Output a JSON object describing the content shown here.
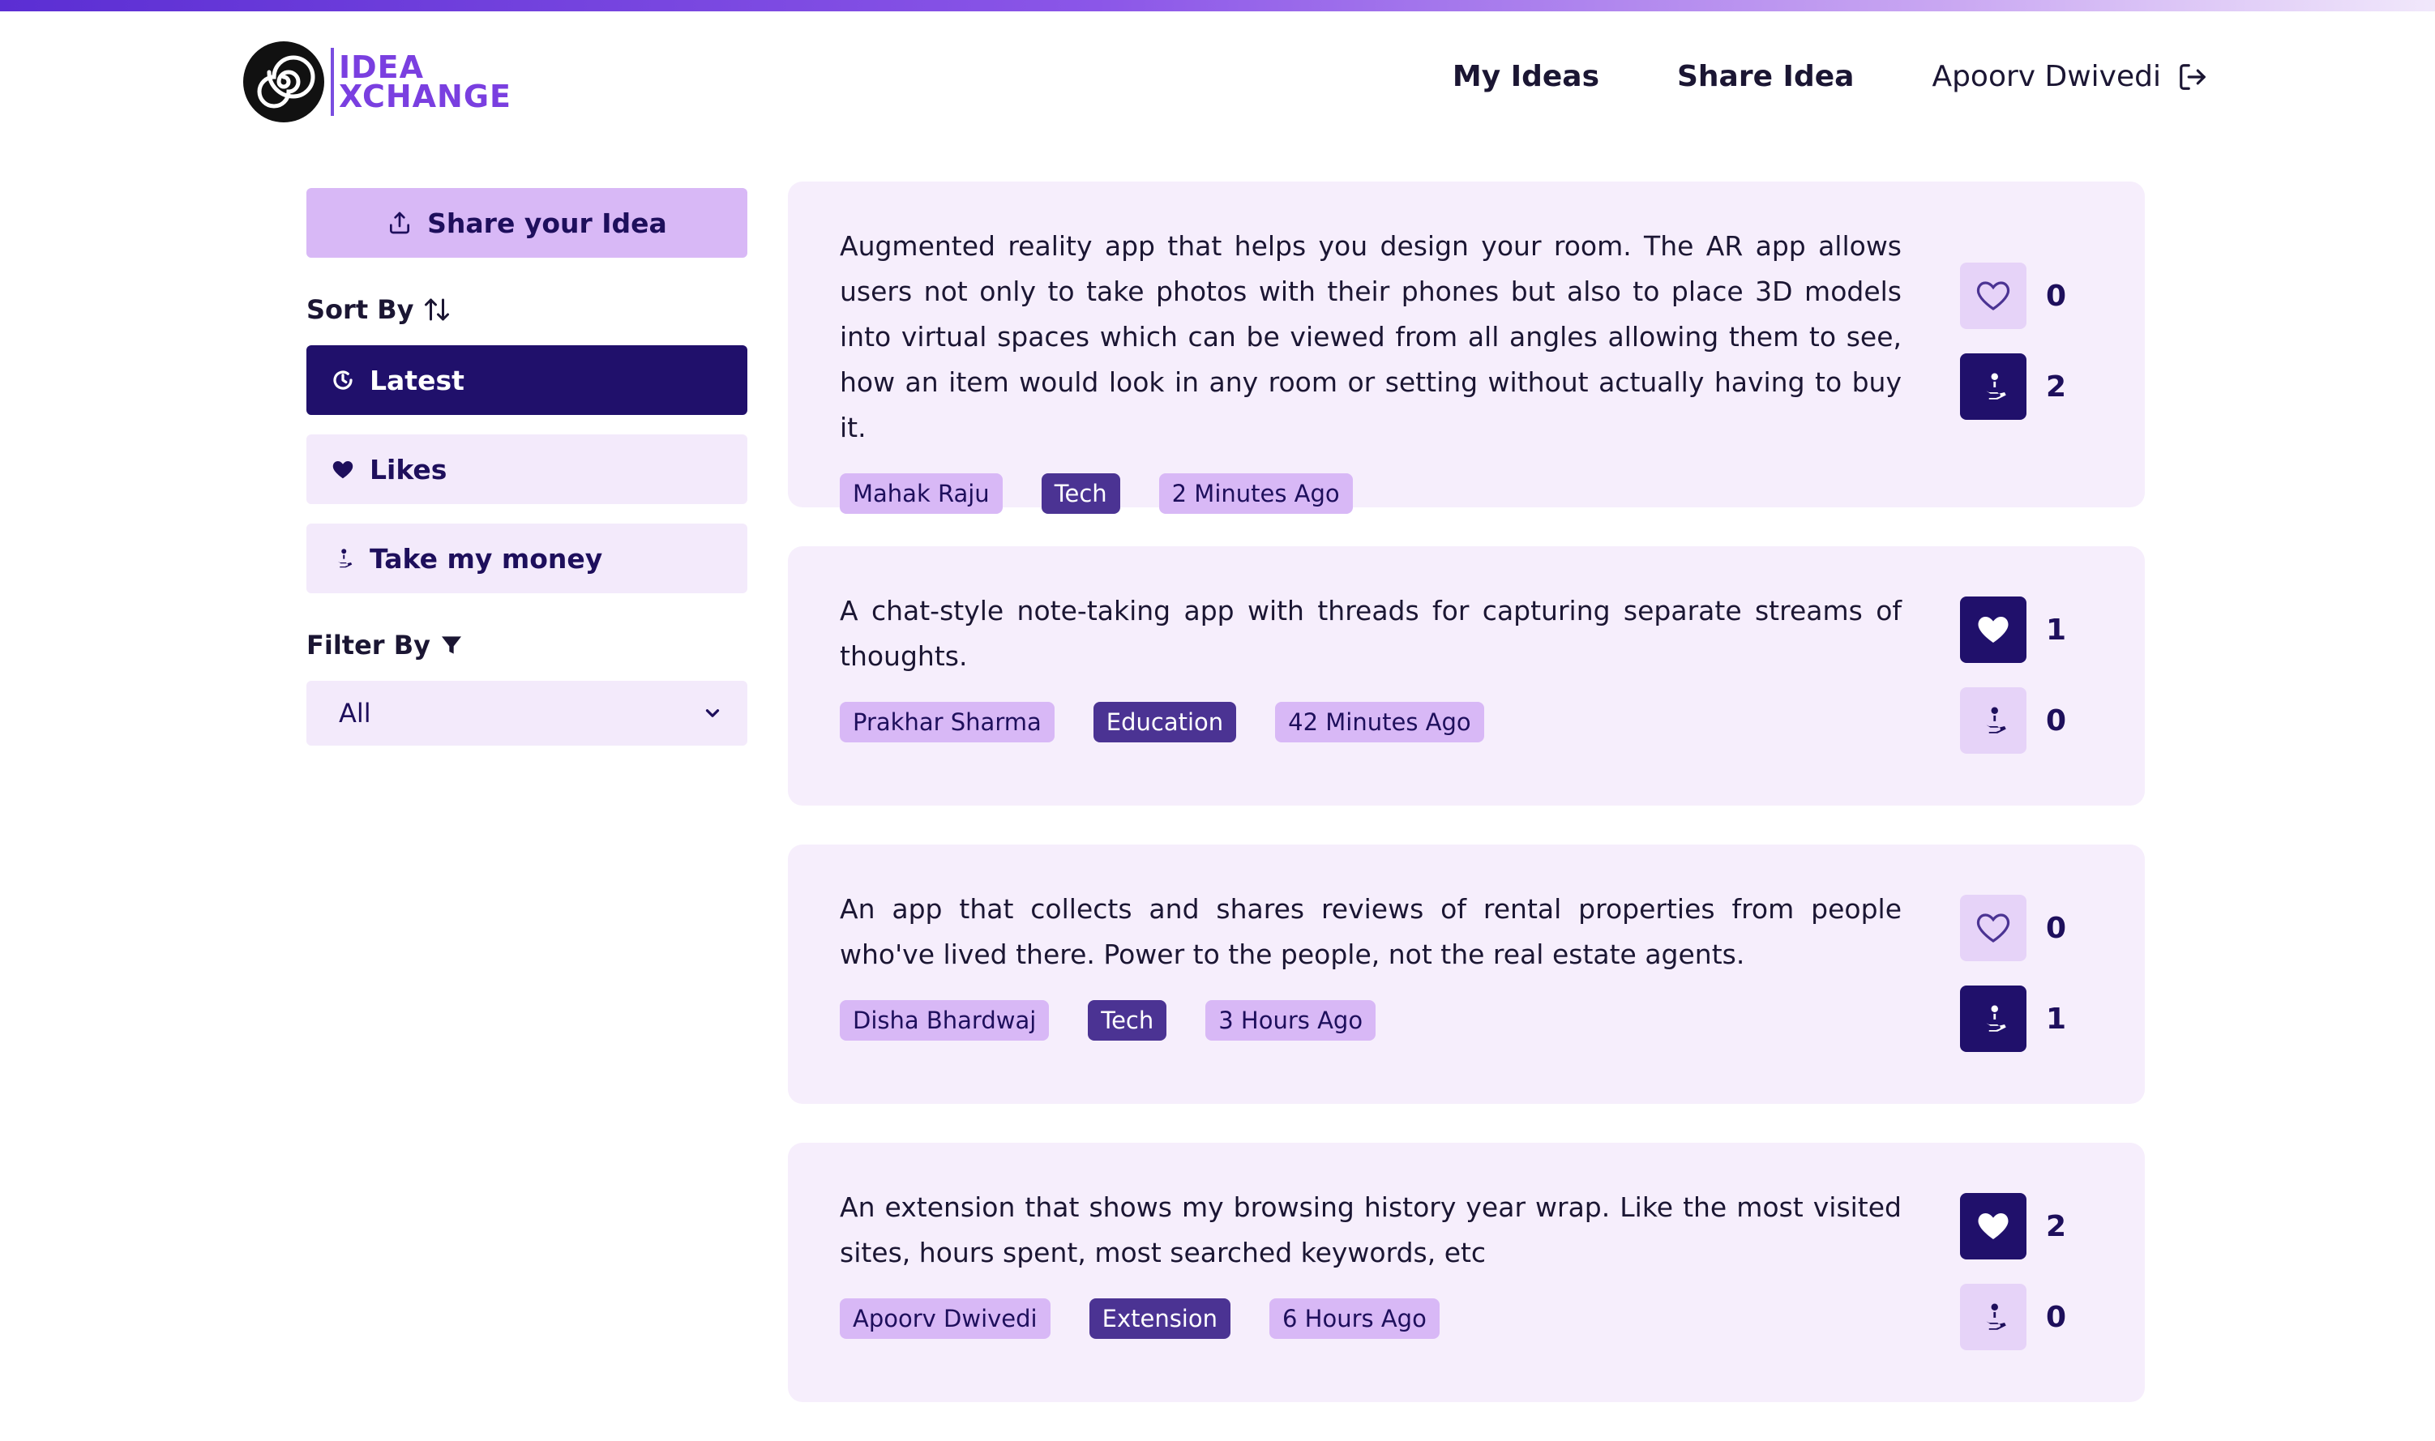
{
  "brand": {
    "line1": "IDEA",
    "line2": "XCHANGE"
  },
  "nav": {
    "my_ideas": "My Ideas",
    "share_idea": "Share Idea",
    "user_name": "Apoorv Dwivedi"
  },
  "sidebar": {
    "share_label": "Share your Idea",
    "sort_title": "Sort By",
    "sort_options": [
      {
        "label": "Latest",
        "active": true
      },
      {
        "label": "Likes",
        "active": false
      },
      {
        "label": "Take my money",
        "active": false
      }
    ],
    "filter_title": "Filter By",
    "filter_value": "All"
  },
  "ideas": [
    {
      "text": "Augmented reality app that helps you design your room. The AR app allows users not only to take photos with their phones but also to place 3D models into virtual spaces which can be viewed from all angles allowing them to see, how an item would look in any room or setting without actually having to buy it.",
      "author": "Mahak Raju",
      "category": "Tech",
      "time": "2 Minutes Ago",
      "likes": "0",
      "liked": false,
      "money": "2",
      "money_on": true
    },
    {
      "text": "A chat-style note-taking app with threads for capturing separate streams of thoughts.",
      "author": "Prakhar Sharma",
      "category": "Education",
      "time": "42 Minutes Ago",
      "likes": "1",
      "liked": true,
      "money": "0",
      "money_on": false
    },
    {
      "text": "An app that collects and shares reviews of rental properties from people who've lived there. Power to the people, not the real estate agents.",
      "author": "Disha Bhardwaj",
      "category": "Tech",
      "time": "3 Hours Ago",
      "likes": "0",
      "liked": false,
      "money": "1",
      "money_on": true
    },
    {
      "text": "An extension that shows my browsing history year wrap. Like the most visited sites, hours spent, most searched keywords, etc",
      "author": "Apoorv Dwivedi",
      "category": "Extension",
      "time": "6 Hours Ago",
      "likes": "2",
      "liked": true,
      "money": "0",
      "money_on": false
    }
  ],
  "colors": {
    "primary": "#20106b",
    "accent": "#d8b8f6",
    "card_bg": "#f6eefc",
    "category_tag": "#4b3393"
  }
}
